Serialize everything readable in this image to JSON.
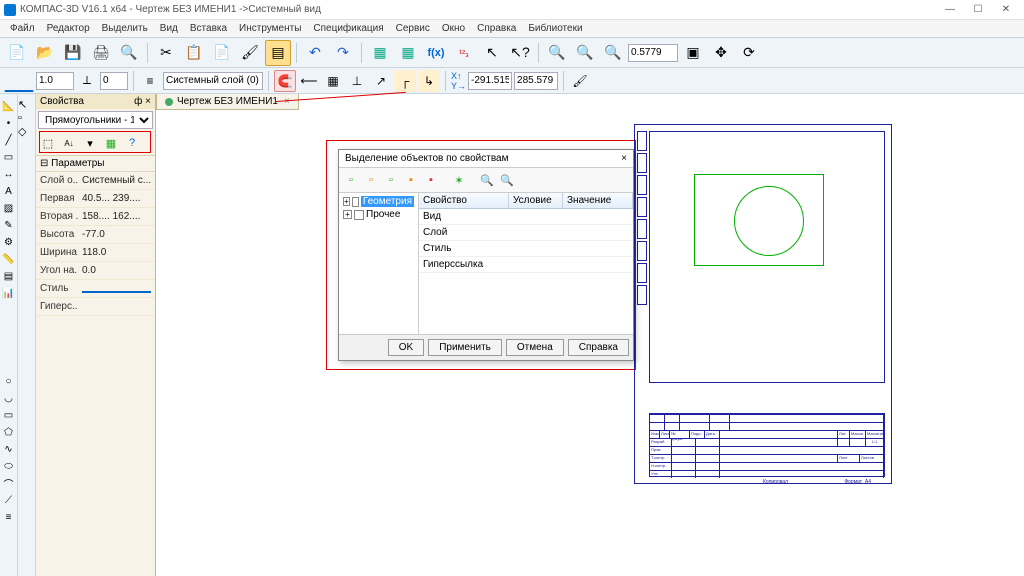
{
  "titlebar": {
    "title": "КОМПАС-3D V16.1 x64 - Чертеж БЕЗ ИМЕНИ1 ->Системный вид"
  },
  "menu": {
    "items": [
      "Файл",
      "Редактор",
      "Выделить",
      "Вид",
      "Вставка",
      "Инструменты",
      "Спецификация",
      "Сервис",
      "Окно",
      "Справка",
      "Библиотеки"
    ]
  },
  "toolbar1": {
    "zoom_value": "0.5779"
  },
  "toolbar2": {
    "scale": "1.0",
    "step": "0",
    "layer": "Системный слой (0)",
    "coord_x": "-291.515",
    "coord_y": "285.579"
  },
  "properties": {
    "panel_title": "Свойства",
    "pin": "ф",
    "close": "×",
    "object_select": "Прямоугольники - 1",
    "section": "Параметры",
    "rows": [
      {
        "label": "Слой о...",
        "value": "Системный с..."
      },
      {
        "label": "Первая ...",
        "value": "40.5...   239...."
      },
      {
        "label": "Вторая ...",
        "value": "158....   162...."
      },
      {
        "label": "Высота ...",
        "value": "-77.0"
      },
      {
        "label": "Ширина...",
        "value": "118.0"
      },
      {
        "label": "Угол на...",
        "value": "0.0"
      },
      {
        "label": "Стиль",
        "value": "———"
      },
      {
        "label": "Гиперс...",
        "value": ""
      }
    ]
  },
  "doc_tab": {
    "name": "Чертеж БЕЗ ИМЕНИ1",
    "close": "×"
  },
  "dialog": {
    "title": "Выделение объектов по свойствам",
    "close": "×",
    "tree": {
      "item1": "Геометрия",
      "item2": "Прочее"
    },
    "grid": {
      "col1": "Свойство",
      "col2": "Условие",
      "col3": "Значение",
      "rows": [
        "Вид",
        "Слой",
        "Стиль",
        "Гиперссылка"
      ]
    },
    "buttons": {
      "ok": "OK",
      "apply": "Применить",
      "cancel": "Отмена",
      "help": "Справка"
    }
  },
  "titleblock": {
    "labels": [
      "Изм",
      "Лист",
      "№ докум.",
      "Подп.",
      "Дата",
      "Разраб.",
      "Пров.",
      "Т.контр.",
      "Н.контр.",
      "Утв.",
      "Лит.",
      "Масса",
      "Масштаб",
      "Лист",
      "Листов",
      "Копировал",
      "Формат",
      "A4"
    ]
  }
}
